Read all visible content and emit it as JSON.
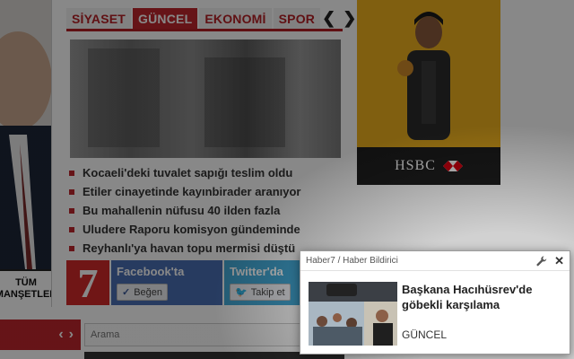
{
  "tabs": [
    {
      "label": "SİYASET",
      "active": false
    },
    {
      "label": "GÜNCEL",
      "active": true
    },
    {
      "label": "EKONOMİ",
      "active": false
    },
    {
      "label": "SPOR",
      "active": false
    }
  ],
  "tab_nav": {
    "prev": "❮",
    "next": "❯"
  },
  "left_column": {
    "line1": "TÜM",
    "line2": "MANŞETLER"
  },
  "headlines": [
    "Kocaeli'deki tuvalet sapığı teslim oldu",
    "Etiler cinayetinde kayınbirader aranıyor",
    "Bu mahallenin nüfusu 40 ilden fazla",
    "Uludere Raporu komisyon gündeminde",
    "Reyhanlı'ya havan topu mermisi düştü"
  ],
  "social": {
    "logo": "7",
    "facebook_title": "Facebook'ta",
    "facebook_button": "Beğen",
    "twitter_title": "Twitter'da",
    "twitter_button": "Takip et"
  },
  "bottom": {
    "prev": "‹",
    "next": "›",
    "search_placeholder": "Arama"
  },
  "ad": {
    "brand": "HSBC"
  },
  "notification": {
    "source": "Haber7 / Haber Bildirici",
    "headline": "Başkana Hacıhüsrev'de göbekli karşılama",
    "category": "GÜNCEL",
    "close": "✕"
  },
  "colors": {
    "accent": "#c0272d",
    "facebook": "#4a6fb5",
    "twitter": "#44a9d6",
    "ad_bg": "#f0b31f"
  },
  "icons": {
    "wrench": "wrench-icon",
    "close": "close-icon"
  }
}
